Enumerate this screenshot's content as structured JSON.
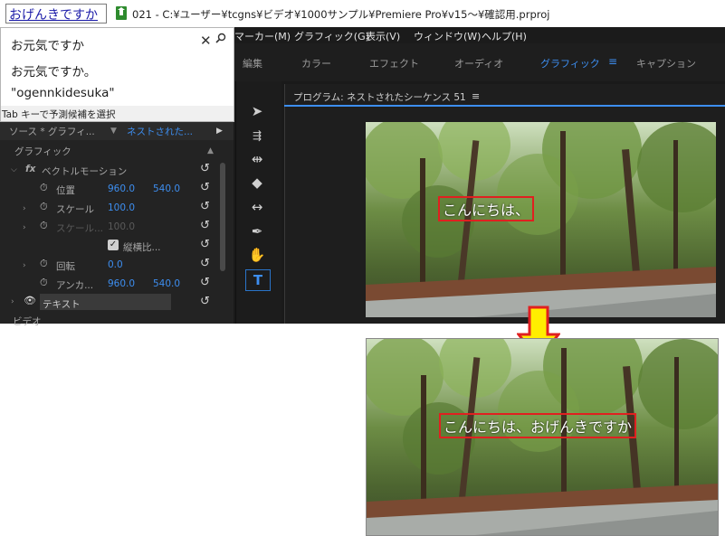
{
  "ime": {
    "composition": "おげんきですか",
    "candidates": [
      "お元気ですか",
      "お元気ですか。",
      "\"ogennkidesuka\""
    ],
    "footer": "Tab キーで予測候補を選択",
    "close_icon": "close-icon",
    "search_icon": "search-icon"
  },
  "window": {
    "title": "021 - C:¥ユーザー¥tcgns¥ビデオ¥1000サンプル¥Premiere Pro¥v15～¥確認用.prproj"
  },
  "menu": {
    "items": [
      "マーカー(M)",
      "グラフィック(G)",
      "表示(V)",
      "ウィンドウ(W)",
      "ヘルプ(H)"
    ]
  },
  "workspaces": {
    "tabs": [
      "編集",
      "カラー",
      "エフェクト",
      "オーディオ",
      "グラフィック",
      "キャプション"
    ],
    "active": "グラフィック",
    "menu_icon": "≡"
  },
  "essential_graphics": {
    "source": "ソース * グラフィ...",
    "sequence": "ネストされた...",
    "section_graphic": "グラフィック",
    "motion": "ベクトルモーション",
    "fx": "fx",
    "position_label": "位置",
    "position_x": "960.0",
    "position_y": "540.0",
    "scale_label": "スケール",
    "scale_value": "100.0",
    "scale_width_label": "スケール...",
    "scale_width_value": "100.0",
    "uniform_scale_label": "縦横比...",
    "rotation_label": "回転",
    "rotation_value": "0.0",
    "anchor_label": "アンカ...",
    "anchor_x": "960.0",
    "anchor_y": "540.0",
    "text_layer": "テキスト",
    "video_label": "ビデオ"
  },
  "program_monitor": {
    "title": "プログラム: ネストされたシーケンス 51",
    "menu_icon": "≡"
  },
  "captions": {
    "before": "こんにちは、",
    "after": "こんにちは、おげんきですか"
  },
  "colors": {
    "accent_blue": "#3d8ef0",
    "caption_box": "#e02020",
    "arrow_fill": "#ffee00",
    "arrow_stroke": "#e02020"
  }
}
